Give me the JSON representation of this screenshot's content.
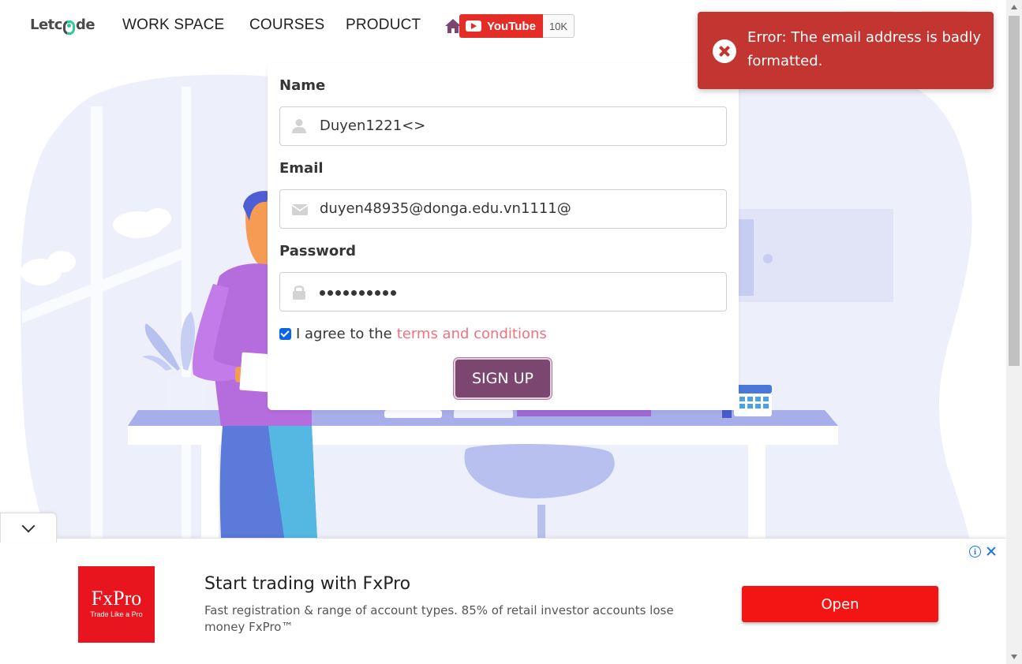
{
  "navbar": {
    "logo_start": "Letc",
    "logo_end": "de",
    "links": [
      "WORK SPACE",
      "COURSES",
      "PRODUCT"
    ],
    "youtube": {
      "label": "YouTube",
      "count": "10K"
    }
  },
  "form": {
    "name": {
      "label": "Name",
      "value": "Duyen1221<>"
    },
    "email": {
      "label": "Email",
      "value": "duyen48935@donga.edu.vn1111@"
    },
    "password": {
      "label": "Password",
      "masked_length": 10
    },
    "agree_prefix": "I agree to the",
    "terms_link": "terms and conditions",
    "agree_checked": true,
    "submit_label": "SIGN UP"
  },
  "toast": {
    "message": "Error: The email address is badly formatted.",
    "color": "#c23531"
  },
  "ad": {
    "brand": "FxPro",
    "tagline": "Trade Like a Pro",
    "title": "Start trading with FxPro",
    "description": "Fast registration & range of account types. 85% of retail investor accounts lose money FxPro™",
    "cta": "Open",
    "info_glyph": "i"
  },
  "colors": {
    "brand_purple": "#7b4670",
    "terms_link": "#f0727f",
    "ad_red": "#f31414",
    "checkbox_blue": "#0a66e6"
  },
  "icons": [
    "home-icon",
    "user-icon",
    "envelope-icon",
    "lock-icon",
    "error-icon",
    "youtube-icon",
    "ad-info-icon",
    "close-icon",
    "chevron-down-icon"
  ]
}
